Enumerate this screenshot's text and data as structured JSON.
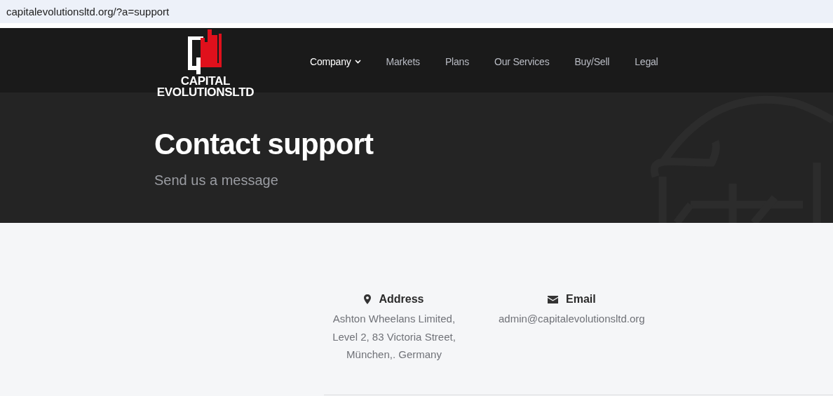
{
  "address_bar": {
    "url": "capitalevolutionsltd.org/?a=support"
  },
  "logo": {
    "line_1": "CAPITAL",
    "line_2": "EVOLUTIONSLTD"
  },
  "nav": [
    {
      "label": "Company",
      "selected": true,
      "dropdown": true
    },
    {
      "label": "Markets",
      "selected": false,
      "dropdown": false
    },
    {
      "label": "Plans",
      "selected": false,
      "dropdown": false
    },
    {
      "label": "Our Services",
      "selected": false,
      "dropdown": false
    },
    {
      "label": "Buy/Sell",
      "selected": false,
      "dropdown": false
    },
    {
      "label": "Legal",
      "selected": false,
      "dropdown": false
    }
  ],
  "hero": {
    "title": "Contact support",
    "subtitle": "Send us a message"
  },
  "contacts": [
    {
      "kind": "address",
      "heading": "Address",
      "lines": [
        "Ashton Wheelans Limited,",
        "Level 2, 83 Victoria Street,",
        "München,. Germany"
      ]
    },
    {
      "kind": "email",
      "heading": "Email",
      "lines": [
        "admin@capitalevolutionsltd.org"
      ]
    }
  ]
}
